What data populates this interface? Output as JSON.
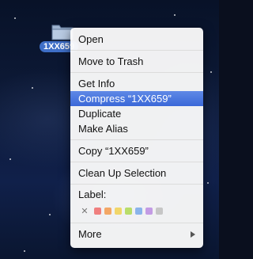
{
  "desktop": {
    "file_name": "1XX659"
  },
  "menu": {
    "open": "Open",
    "move_to_trash": "Move to Trash",
    "get_info": "Get Info",
    "compress": "Compress “1XX659”",
    "duplicate": "Duplicate",
    "make_alias": "Make Alias",
    "copy": "Copy “1XX659”",
    "clean_up_selection": "Clean Up Selection",
    "label_title": "Label:",
    "label_clear_symbol": "✕",
    "label_colors": [
      "#f07f7f",
      "#f3a766",
      "#f1d66a",
      "#b9dd6a",
      "#8bb4ea",
      "#c39be4",
      "#c6c6c6"
    ],
    "more": "More"
  },
  "colors": {
    "selection": "#3a68d8",
    "file_label_bg": "#3f6fc7"
  }
}
